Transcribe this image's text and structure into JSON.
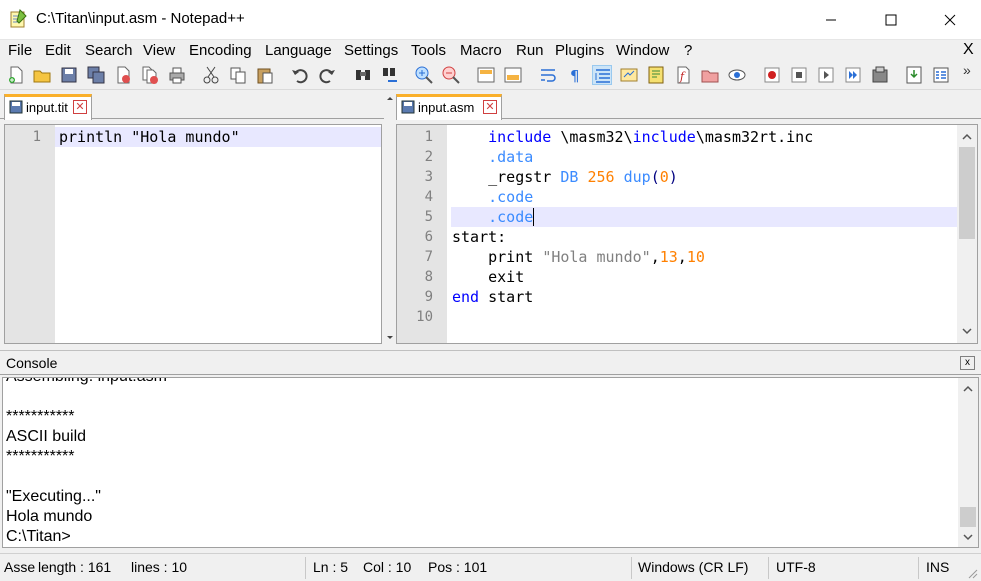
{
  "window": {
    "title": "C:\\Titan\\input.asm - Notepad++",
    "icon": "notepad-icon",
    "minimize_glyph": "—",
    "maximize_glyph": "☐",
    "close_glyph": "✕"
  },
  "menu": {
    "items": [
      "File",
      "Edit",
      "Search",
      "View",
      "Encoding",
      "Language",
      "Settings",
      "Tools",
      "Macro",
      "Run",
      "Plugins",
      "Window",
      "?"
    ],
    "close_label": "X"
  },
  "toolbar": {
    "more_glyph": "»",
    "icons": [
      "new-file-icon",
      "open-file-icon",
      "save-icon",
      "save-all-icon",
      "close-icon",
      "close-all-icon",
      "print-icon",
      "cut-icon",
      "copy-icon",
      "paste-icon",
      "undo-icon",
      "redo-icon",
      "find-icon",
      "replace-icon",
      "zoom-in-icon",
      "zoom-out-icon",
      "sync-vertical-icon",
      "sync-horizontal-icon",
      "word-wrap-icon",
      "show-all-chars-icon",
      "indent-guide-icon",
      "user-language-icon",
      "document-map-icon",
      "function-list-icon",
      "folder-workspace-icon",
      "monitoring-icon",
      "record-macro-icon",
      "stop-macro-icon",
      "play-macro-icon",
      "run-macro-multiple-icon",
      "save-macro-icon",
      "plugin-a-icon",
      "plugin-b-icon"
    ]
  },
  "left_editor": {
    "tab_label": "input.tit",
    "tab_close": "✕",
    "lines": [
      {
        "num": "1",
        "text": "println \"Hola mundo\""
      }
    ]
  },
  "right_editor": {
    "tab_label": "input.asm",
    "tab_close": "✕",
    "line_numbers": [
      "1",
      "2",
      "3",
      "4",
      "5",
      "6",
      "7",
      "8",
      "9",
      "10"
    ],
    "lines": [
      [
        {
          "t": "    "
        },
        {
          "t": "include",
          "c": "kw"
        },
        {
          "t": " \\masm32\\"
        },
        {
          "t": "include",
          "c": "kw"
        },
        {
          "t": "\\masm32rt.inc"
        }
      ],
      [
        {
          "t": "    "
        },
        {
          "t": ".data",
          "c": "dir"
        }
      ],
      [
        {
          "t": "    _regstr "
        },
        {
          "t": "DB",
          "c": "dir"
        },
        {
          "t": " "
        },
        {
          "t": "256",
          "c": "num"
        },
        {
          "t": " "
        },
        {
          "t": "dup",
          "c": "dir"
        },
        {
          "t": "(",
          "c": "op"
        },
        {
          "t": "0",
          "c": "num"
        },
        {
          "t": ")",
          "c": "op"
        }
      ],
      [
        {
          "t": "    "
        },
        {
          "t": ".code",
          "c": "dir"
        }
      ],
      [
        {
          "t": "    "
        },
        {
          "t": ".code",
          "c": "dir"
        }
      ],
      [
        {
          "t": "start:"
        }
      ],
      [
        {
          "t": "    print "
        },
        {
          "t": "\"Hola mundo\"",
          "c": "str"
        },
        {
          "t": ","
        },
        {
          "t": "13",
          "c": "num"
        },
        {
          "t": ","
        },
        {
          "t": "10",
          "c": "num"
        }
      ],
      [
        {
          "t": "    exit"
        }
      ],
      [
        {
          "t": "end",
          "c": "kw"
        },
        {
          "t": " start"
        }
      ],
      []
    ]
  },
  "console": {
    "title": "Console",
    "close_glyph": "x",
    "lines": [
      "Assembling: input.asm",
      "",
      "***********",
      "ASCII build",
      "***********",
      "",
      "\"Executing...\"",
      "Hola mundo",
      "C:\\Titan>"
    ]
  },
  "status": {
    "lang": "Asse",
    "length": "length : 161",
    "lines": "lines : 10",
    "ln": "Ln : 5",
    "col": "Col : 10",
    "pos": "Pos : 101",
    "eol": "Windows (CR LF)",
    "encoding": "UTF-8",
    "mode": "INS"
  },
  "colors": {
    "keyword": "#0000ff",
    "directive": "#3b8bff",
    "number": "#ff8000",
    "string": "#808080",
    "current_line": "#e8e8ff",
    "tab_accent": "#fab02b"
  }
}
